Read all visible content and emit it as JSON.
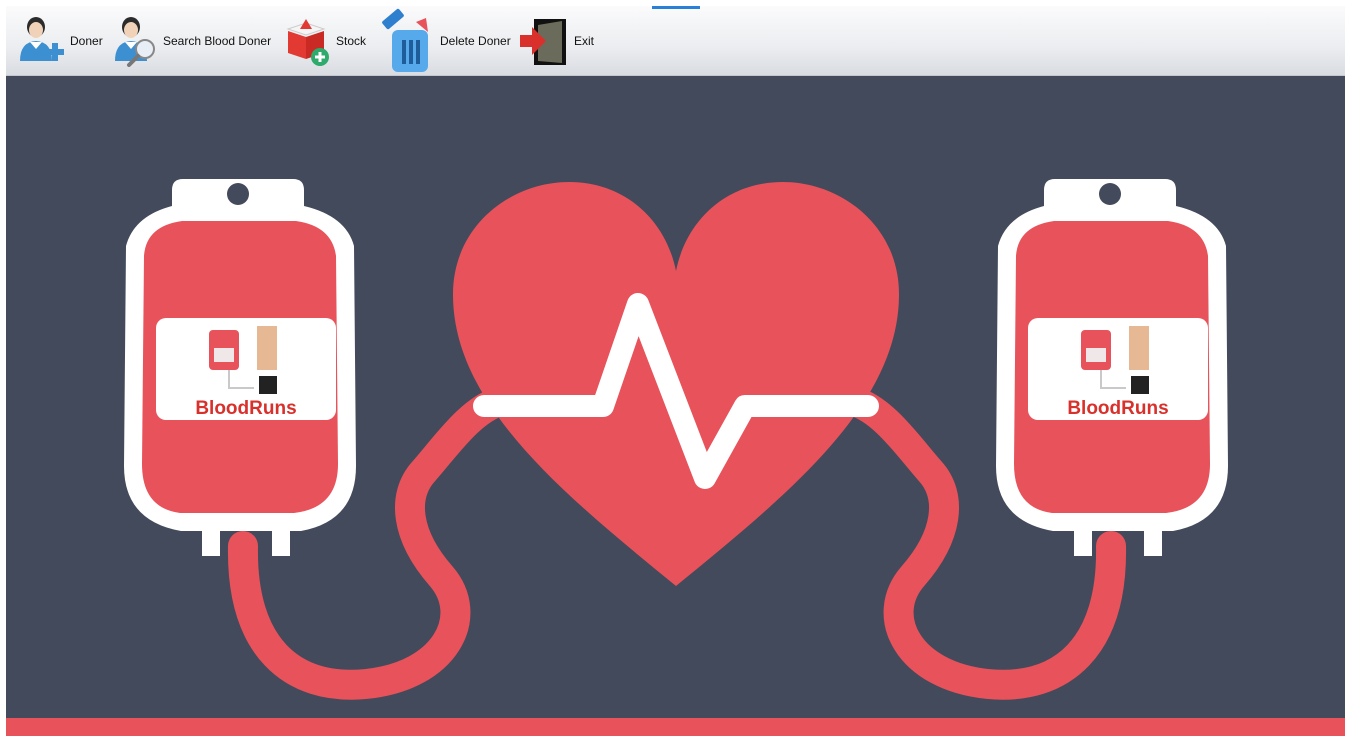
{
  "toolbar": {
    "buttons": [
      {
        "label": "Doner",
        "icon": "add-user-icon"
      },
      {
        "label": "Search Blood Doner",
        "icon": "search-user-icon"
      },
      {
        "label": "Stock",
        "icon": "stock-box-icon"
      },
      {
        "label": "Delete Doner",
        "icon": "trash-icon"
      },
      {
        "label": "Exit",
        "icon": "exit-door-icon"
      }
    ]
  },
  "banner": {
    "logo_text_left": "BloodRuns",
    "logo_text_right": "BloodRuns"
  },
  "colors": {
    "background": "#434a5b",
    "blood_red": "#e8525a",
    "bag_white": "#ffffff"
  }
}
